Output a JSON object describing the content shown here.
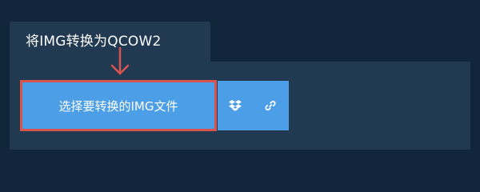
{
  "title": "将IMG转换为QCOW2",
  "buttons": {
    "choose_file": "选择要转换的IMG文件"
  },
  "icons": {
    "dropbox": "dropbox-icon",
    "link": "link-icon",
    "arrow": "down-arrow-icon"
  },
  "colors": {
    "page_background": "#12263b",
    "panel_background": "#213a52",
    "button_blue": "#4c9ee6",
    "highlight_red": "#d9534f",
    "text": "#ffffff"
  }
}
